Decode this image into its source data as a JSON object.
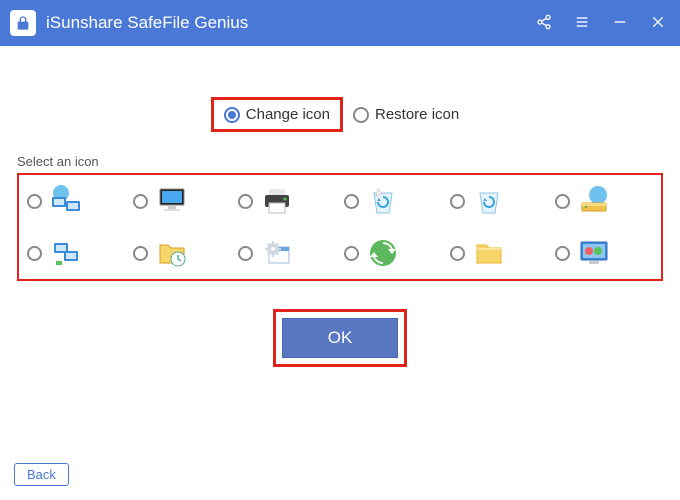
{
  "app": {
    "title": "iSunshare SafeFile Genius"
  },
  "colors": {
    "primary": "#4a78d6",
    "highlight": "#e2231a",
    "okButton": "#5a77c2"
  },
  "modeRadios": {
    "change": {
      "label": "Change icon",
      "selected": true
    },
    "restore": {
      "label": "Restore icon",
      "selected": false
    }
  },
  "section": {
    "label": "Select an icon"
  },
  "icons": [
    {
      "name": "network-computers-icon"
    },
    {
      "name": "monitor-icon"
    },
    {
      "name": "printer-icon"
    },
    {
      "name": "recycle-bin-full-icon"
    },
    {
      "name": "recycle-bin-empty-icon"
    },
    {
      "name": "network-drive-icon"
    },
    {
      "name": "network-folder-icon"
    },
    {
      "name": "folder-history-icon"
    },
    {
      "name": "settings-gear-icon"
    },
    {
      "name": "sync-icon"
    },
    {
      "name": "folder-icon"
    },
    {
      "name": "control-panel-icon"
    }
  ],
  "buttons": {
    "ok": "OK",
    "back": "Back"
  }
}
